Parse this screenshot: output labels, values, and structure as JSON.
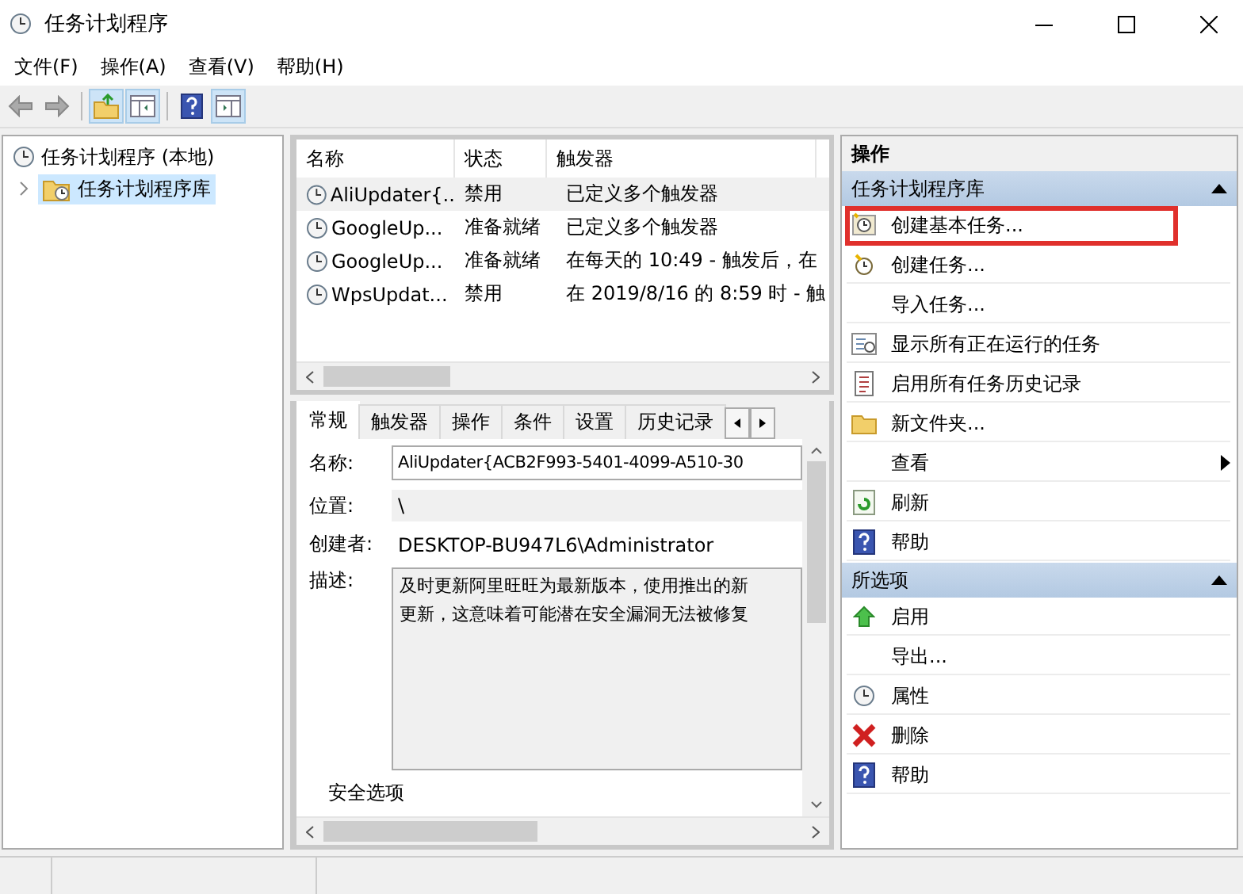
{
  "window": {
    "title": "任务计划程序"
  },
  "menu": [
    "文件(F)",
    "操作(A)",
    "查看(V)",
    "帮助(H)"
  ],
  "tree": [
    {
      "label": "任务计划程序 (本地)",
      "selected": false,
      "children": [
        {
          "label": "任务计划程序库",
          "selected": true,
          "expanded": false
        }
      ]
    }
  ],
  "tasks": {
    "columns": [
      "名称",
      "状态",
      "触发器"
    ],
    "rows": [
      {
        "name": "AliUpdater{...",
        "status": "禁用",
        "trigger": "已定义多个触发器",
        "selected": true
      },
      {
        "name": "GoogleUp...",
        "status": "准备就绪",
        "trigger": "已定义多个触发器",
        "selected": false
      },
      {
        "name": "GoogleUp...",
        "status": "准备就绪",
        "trigger": "在每天的 10:49 - 触发后，在",
        "selected": false
      },
      {
        "name": "WpsUpdat...",
        "status": "禁用",
        "trigger": "在 2019/8/16 的 8:59 时 - 触",
        "selected": false
      }
    ]
  },
  "details": {
    "tabs": [
      {
        "label": "常规",
        "selected": true
      },
      {
        "label": "触发器",
        "selected": false
      },
      {
        "label": "操作",
        "selected": false
      },
      {
        "label": "条件",
        "selected": false
      },
      {
        "label": "设置",
        "selected": false
      },
      {
        "label": "历史记录",
        "selected": false
      }
    ],
    "fields": [
      {
        "kind": "input",
        "label": "名称:",
        "value": "AliUpdater{ACB2F993-5401-4099-A510-30"
      },
      {
        "kind": "readonly",
        "label": "位置:",
        "value": "\\"
      },
      {
        "kind": "text",
        "label": "创建者:",
        "value": "DESKTOP-BU947L6\\Administrator"
      },
      {
        "kind": "textarea",
        "label": "描述:",
        "lines": [
          "及时更新阿里旺旺为最新版本，使用推出的新",
          "更新，这意味着可能潜在安全漏洞无法被修复"
        ]
      }
    ],
    "section": "安全选项"
  },
  "actions": {
    "title": "操作",
    "groups": [
      {
        "title": "任务计划程序库",
        "expanded": true,
        "items": [
          {
            "label": "创建基本任务...",
            "kind": "wizard",
            "highlighted": true,
            "submenu": false
          },
          {
            "label": "创建任务...",
            "kind": "newtask",
            "highlighted": false,
            "submenu": false
          },
          {
            "label": "导入任务...",
            "kind": "plain",
            "highlighted": false,
            "submenu": false
          },
          {
            "label": "显示所有正在运行的任务",
            "kind": "running",
            "highlighted": false,
            "submenu": false
          },
          {
            "label": "启用所有任务历史记录",
            "kind": "history",
            "highlighted": false,
            "submenu": false
          },
          {
            "label": "新文件夹...",
            "kind": "folder",
            "highlighted": false,
            "submenu": false
          },
          {
            "label": "查看",
            "kind": "plain",
            "highlighted": false,
            "submenu": true
          },
          {
            "label": "刷新",
            "kind": "refresh",
            "highlighted": false,
            "submenu": false
          },
          {
            "label": "帮助",
            "kind": "help",
            "highlighted": false,
            "submenu": false
          }
        ]
      },
      {
        "title": "所选项",
        "expanded": true,
        "items": [
          {
            "label": "启用",
            "kind": "enable",
            "highlighted": false,
            "submenu": false
          },
          {
            "label": "导出...",
            "kind": "plain",
            "highlighted": false,
            "submenu": false
          },
          {
            "label": "属性",
            "kind": "properties",
            "highlighted": false,
            "submenu": false
          },
          {
            "label": "删除",
            "kind": "delete",
            "highlighted": false,
            "submenu": false
          },
          {
            "label": "帮助",
            "kind": "help",
            "highlighted": false,
            "submenu": false
          }
        ]
      }
    ]
  }
}
